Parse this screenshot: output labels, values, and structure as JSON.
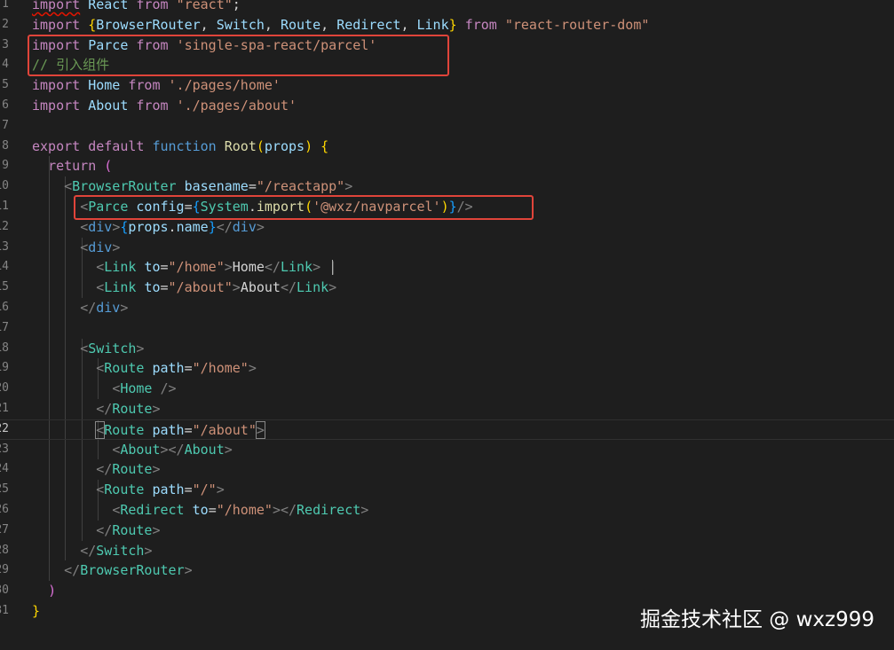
{
  "editor": {
    "line_numbers": [
      "1",
      "2",
      "3",
      "4",
      "5",
      "6",
      "7",
      "8",
      "9",
      "10",
      "11",
      "12",
      "13",
      "14",
      "15",
      "16",
      "17",
      "18",
      "19",
      "20",
      "21",
      "22",
      "23",
      "24",
      "25",
      "26",
      "27",
      "28",
      "29",
      "30",
      "31"
    ],
    "active_line": "22",
    "lines": [
      [
        [
          "kw",
          "import"
        ],
        [
          "txt",
          " "
        ],
        [
          "var",
          "React"
        ],
        [
          "txt",
          " "
        ],
        [
          "kw",
          "from"
        ],
        [
          "txt",
          " "
        ],
        [
          "str",
          "\"react\""
        ],
        [
          "txt",
          ";"
        ]
      ],
      [
        [
          "kw",
          "import"
        ],
        [
          "txt",
          " "
        ],
        [
          "b1",
          "{"
        ],
        [
          "var",
          "BrowserRouter"
        ],
        [
          "txt",
          ", "
        ],
        [
          "var",
          "Switch"
        ],
        [
          "txt",
          ", "
        ],
        [
          "var",
          "Route"
        ],
        [
          "txt",
          ", "
        ],
        [
          "var",
          "Redirect"
        ],
        [
          "txt",
          ", "
        ],
        [
          "var",
          "Link"
        ],
        [
          "b1",
          "}"
        ],
        [
          "txt",
          " "
        ],
        [
          "kw",
          "from"
        ],
        [
          "txt",
          " "
        ],
        [
          "str",
          "\"react-router-dom\""
        ]
      ],
      [
        [
          "kw",
          "import"
        ],
        [
          "txt",
          " "
        ],
        [
          "var",
          "Parce"
        ],
        [
          "txt",
          " "
        ],
        [
          "kw",
          "from"
        ],
        [
          "txt",
          " "
        ],
        [
          "str",
          "'single-spa-react/parcel'"
        ]
      ],
      [
        [
          "cmt",
          "// 引入组件"
        ]
      ],
      [
        [
          "kw",
          "import"
        ],
        [
          "txt",
          " "
        ],
        [
          "var",
          "Home"
        ],
        [
          "txt",
          " "
        ],
        [
          "kw",
          "from"
        ],
        [
          "txt",
          " "
        ],
        [
          "str",
          "'./pages/home'"
        ]
      ],
      [
        [
          "kw",
          "import"
        ],
        [
          "txt",
          " "
        ],
        [
          "var",
          "About"
        ],
        [
          "txt",
          " "
        ],
        [
          "kw",
          "from"
        ],
        [
          "txt",
          " "
        ],
        [
          "str",
          "'./pages/about'"
        ]
      ],
      [],
      [
        [
          "kw",
          "export"
        ],
        [
          "txt",
          " "
        ],
        [
          "kw",
          "default"
        ],
        [
          "txt",
          " "
        ],
        [
          "sk",
          "function"
        ],
        [
          "txt",
          " "
        ],
        [
          "fn",
          "Root"
        ],
        [
          "b1",
          "("
        ],
        [
          "var",
          "props"
        ],
        [
          "b1",
          ")"
        ],
        [
          "txt",
          " "
        ],
        [
          "b1",
          "{"
        ]
      ],
      [
        [
          "txt",
          "  "
        ],
        [
          "kw",
          "return"
        ],
        [
          "txt",
          " "
        ],
        [
          "b2",
          "("
        ]
      ],
      [
        [
          "txt",
          "    "
        ],
        [
          "br",
          "<"
        ],
        [
          "tag",
          "BrowserRouter"
        ],
        [
          "txt",
          " "
        ],
        [
          "var",
          "basename"
        ],
        [
          "txt",
          "="
        ],
        [
          "str",
          "\"/reactapp\""
        ],
        [
          "br",
          ">"
        ]
      ],
      [
        [
          "txt",
          "      "
        ],
        [
          "br",
          "<"
        ],
        [
          "tag",
          "Parce"
        ],
        [
          "txt",
          " "
        ],
        [
          "var",
          "config"
        ],
        [
          "txt",
          "="
        ],
        [
          "b3",
          "{"
        ],
        [
          "tag",
          "System"
        ],
        [
          "txt",
          "."
        ],
        [
          "fn",
          "import"
        ],
        [
          "b1",
          "("
        ],
        [
          "str",
          "'@wxz/navparcel'"
        ],
        [
          "b1",
          ")"
        ],
        [
          "b3",
          "}"
        ],
        [
          "br",
          "/>"
        ]
      ],
      [
        [
          "txt",
          "      "
        ],
        [
          "br",
          "<"
        ],
        [
          "sk",
          "div"
        ],
        [
          "br",
          ">"
        ],
        [
          "b3",
          "{"
        ],
        [
          "var",
          "props"
        ],
        [
          "txt",
          "."
        ],
        [
          "var",
          "name"
        ],
        [
          "b3",
          "}"
        ],
        [
          "br",
          "</"
        ],
        [
          "sk",
          "div"
        ],
        [
          "br",
          ">"
        ]
      ],
      [
        [
          "txt",
          "      "
        ],
        [
          "br",
          "<"
        ],
        [
          "sk",
          "div"
        ],
        [
          "br",
          ">"
        ]
      ],
      [
        [
          "txt",
          "        "
        ],
        [
          "br",
          "<"
        ],
        [
          "tag",
          "Link"
        ],
        [
          "txt",
          " "
        ],
        [
          "var",
          "to"
        ],
        [
          "txt",
          "="
        ],
        [
          "str",
          "\"/home\""
        ],
        [
          "br",
          ">"
        ],
        [
          "txt",
          "Home"
        ],
        [
          "br",
          "</"
        ],
        [
          "tag",
          "Link"
        ],
        [
          "br",
          ">"
        ],
        [
          "txt",
          " |"
        ]
      ],
      [
        [
          "txt",
          "        "
        ],
        [
          "br",
          "<"
        ],
        [
          "tag",
          "Link"
        ],
        [
          "txt",
          " "
        ],
        [
          "var",
          "to"
        ],
        [
          "txt",
          "="
        ],
        [
          "str",
          "\"/about\""
        ],
        [
          "br",
          ">"
        ],
        [
          "txt",
          "About"
        ],
        [
          "br",
          "</"
        ],
        [
          "tag",
          "Link"
        ],
        [
          "br",
          ">"
        ]
      ],
      [
        [
          "txt",
          "      "
        ],
        [
          "br",
          "</"
        ],
        [
          "sk",
          "div"
        ],
        [
          "br",
          ">"
        ]
      ],
      [],
      [
        [
          "txt",
          "      "
        ],
        [
          "br",
          "<"
        ],
        [
          "tag",
          "Switch"
        ],
        [
          "br",
          ">"
        ]
      ],
      [
        [
          "txt",
          "        "
        ],
        [
          "br",
          "<"
        ],
        [
          "tag",
          "Route"
        ],
        [
          "txt",
          " "
        ],
        [
          "var",
          "path"
        ],
        [
          "txt",
          "="
        ],
        [
          "str",
          "\"/home\""
        ],
        [
          "br",
          ">"
        ]
      ],
      [
        [
          "txt",
          "          "
        ],
        [
          "br",
          "<"
        ],
        [
          "tag",
          "Home"
        ],
        [
          "txt",
          " "
        ],
        [
          "br",
          "/>"
        ]
      ],
      [
        [
          "txt",
          "        "
        ],
        [
          "br",
          "</"
        ],
        [
          "tag",
          "Route"
        ],
        [
          "br",
          ">"
        ]
      ],
      [
        [
          "txt",
          "        "
        ],
        [
          "br",
          "<"
        ],
        [
          "tag",
          "Route"
        ],
        [
          "txt",
          " "
        ],
        [
          "var",
          "path"
        ],
        [
          "txt",
          "="
        ],
        [
          "str",
          "\"/about\""
        ],
        [
          "br",
          ">"
        ]
      ],
      [
        [
          "txt",
          "          "
        ],
        [
          "br",
          "<"
        ],
        [
          "tag",
          "About"
        ],
        [
          "br",
          "></"
        ],
        [
          "tag",
          "About"
        ],
        [
          "br",
          ">"
        ]
      ],
      [
        [
          "txt",
          "        "
        ],
        [
          "br",
          "</"
        ],
        [
          "tag",
          "Route"
        ],
        [
          "br",
          ">"
        ]
      ],
      [
        [
          "txt",
          "        "
        ],
        [
          "br",
          "<"
        ],
        [
          "tag",
          "Route"
        ],
        [
          "txt",
          " "
        ],
        [
          "var",
          "path"
        ],
        [
          "txt",
          "="
        ],
        [
          "str",
          "\"/\""
        ],
        [
          "br",
          ">"
        ]
      ],
      [
        [
          "txt",
          "          "
        ],
        [
          "br",
          "<"
        ],
        [
          "tag",
          "Redirect"
        ],
        [
          "txt",
          " "
        ],
        [
          "var",
          "to"
        ],
        [
          "txt",
          "="
        ],
        [
          "str",
          "\"/home\""
        ],
        [
          "br",
          "></"
        ],
        [
          "tag",
          "Redirect"
        ],
        [
          "br",
          ">"
        ]
      ],
      [
        [
          "txt",
          "        "
        ],
        [
          "br",
          "</"
        ],
        [
          "tag",
          "Route"
        ],
        [
          "br",
          ">"
        ]
      ],
      [
        [
          "txt",
          "      "
        ],
        [
          "br",
          "</"
        ],
        [
          "tag",
          "Switch"
        ],
        [
          "br",
          ">"
        ]
      ],
      [
        [
          "txt",
          "    "
        ],
        [
          "br",
          "</"
        ],
        [
          "tag",
          "BrowserRouter"
        ],
        [
          "br",
          ">"
        ]
      ],
      [
        [
          "txt",
          "  "
        ],
        [
          "b2",
          ")"
        ]
      ],
      [
        [
          "b1",
          "}"
        ]
      ]
    ]
  },
  "watermark": {
    "text": "掘金技术社区 @ wxz999"
  },
  "colors": {
    "background": "#1e1e1e",
    "keyword": "#c586c0",
    "storage": "#569cd6",
    "variable": "#9cdcfe",
    "string": "#ce9178",
    "function": "#dcdcaa",
    "comment": "#6a9955",
    "component": "#4ec9b0",
    "punctuation": "#808080",
    "highlight_box": "#e0443a"
  }
}
